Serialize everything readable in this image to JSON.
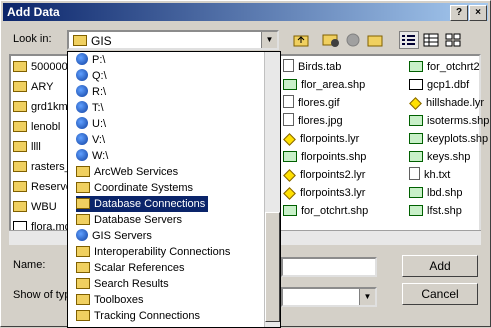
{
  "window": {
    "title": "Add Data"
  },
  "lookin": {
    "label": "Look in:",
    "value": "GIS"
  },
  "left_items": [
    "500000",
    "ARY",
    "grd1km",
    "lenobl",
    "llll",
    "rasters_",
    "Reserve",
    "WBU",
    "flora.mc"
  ],
  "col2": [
    {
      "name": "Birds.tab",
      "icon": "file"
    },
    {
      "name": "flor_area.shp",
      "icon": "shp"
    },
    {
      "name": "flores.gif",
      "icon": "file"
    },
    {
      "name": "flores.jpg",
      "icon": "file"
    },
    {
      "name": "florpoints.lyr",
      "icon": "lyr"
    },
    {
      "name": "florpoints.shp",
      "icon": "shp"
    },
    {
      "name": "florpoints2.lyr",
      "icon": "lyr"
    },
    {
      "name": "florpoints3.lyr",
      "icon": "lyr"
    },
    {
      "name": "for_otchrt.shp",
      "icon": "shp"
    }
  ],
  "col3": [
    {
      "name": "for_otchrt2",
      "icon": "shp"
    },
    {
      "name": "gcp1.dbf",
      "icon": "dbf"
    },
    {
      "name": "hillshade.lyr",
      "icon": "lyr"
    },
    {
      "name": "isoterms.shp",
      "icon": "shp"
    },
    {
      "name": "keyplots.shp",
      "icon": "shp"
    },
    {
      "name": "keys.shp",
      "icon": "shp"
    },
    {
      "name": "kh.txt",
      "icon": "file"
    },
    {
      "name": "lbd.shp",
      "icon": "shp"
    },
    {
      "name": "lfst.shp",
      "icon": "shp"
    }
  ],
  "dropdown": [
    {
      "label": "P:\\",
      "icon": "globe"
    },
    {
      "label": "Q:\\",
      "icon": "globe"
    },
    {
      "label": "R:\\",
      "icon": "globe"
    },
    {
      "label": "T:\\",
      "icon": "globe"
    },
    {
      "label": "U:\\",
      "icon": "globe"
    },
    {
      "label": "V:\\",
      "icon": "globe"
    },
    {
      "label": "W:\\",
      "icon": "globe"
    },
    {
      "label": "ArcWeb Services",
      "icon": "folder"
    },
    {
      "label": "Coordinate Systems",
      "icon": "folder"
    },
    {
      "label": "Database Connections",
      "icon": "folder",
      "selected": true
    },
    {
      "label": "Database Servers",
      "icon": "folder"
    },
    {
      "label": "GIS Servers",
      "icon": "globe"
    },
    {
      "label": "Interoperability Connections",
      "icon": "folder"
    },
    {
      "label": "Scalar References",
      "icon": "folder"
    },
    {
      "label": "Search Results",
      "icon": "folder"
    },
    {
      "label": "Toolboxes",
      "icon": "folder"
    },
    {
      "label": "Tracking Connections",
      "icon": "folder"
    }
  ],
  "name_label": "Name:",
  "show_label": "Show of typ",
  "buttons": {
    "add": "Add",
    "cancel": "Cancel"
  },
  "titlebar_buttons": {
    "help": "?",
    "close": "×"
  },
  "toolbar_icons": [
    "up-folder-icon",
    "connect-icon",
    "disconnect-icon",
    "new-folder-icon",
    "list-view-icon",
    "details-view-icon",
    "thumbnails-view-icon"
  ]
}
